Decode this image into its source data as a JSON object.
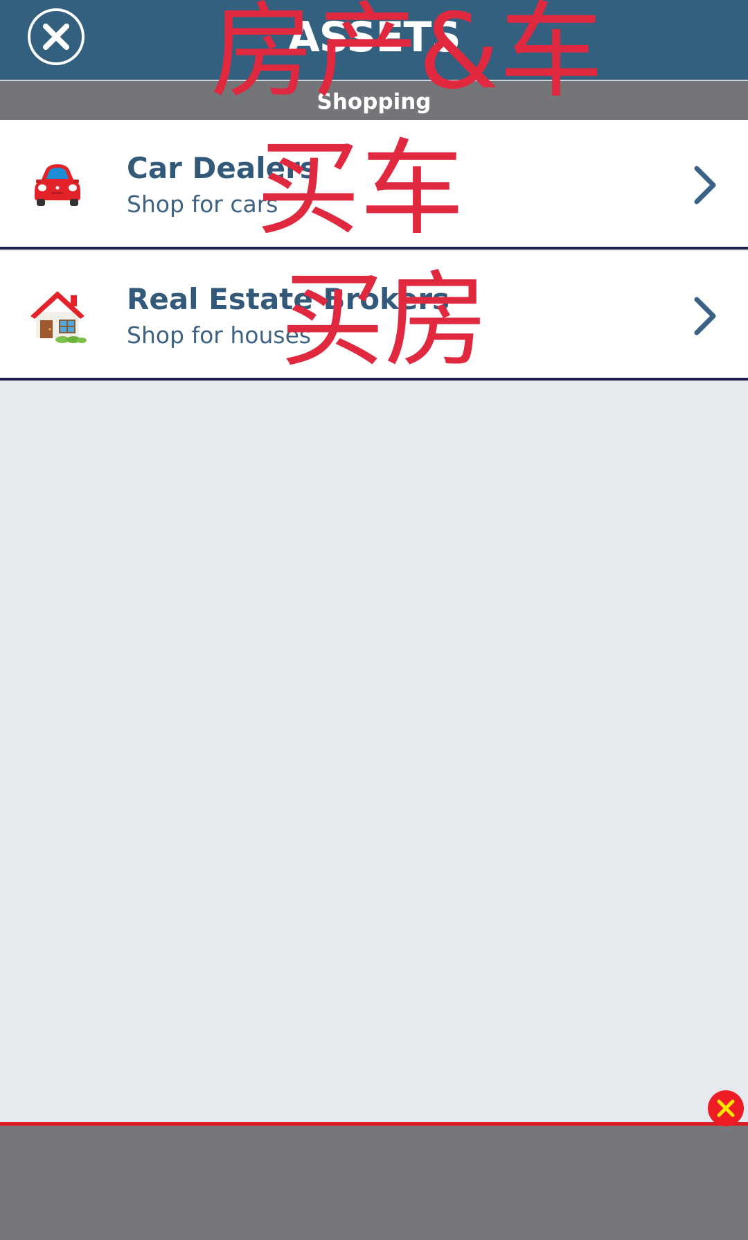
{
  "header": {
    "title": "ASSETS",
    "close_icon": "close-circle-icon",
    "background_color": "#34607f"
  },
  "subheader": {
    "title": "Shopping"
  },
  "items": [
    {
      "title": "Car Dealers",
      "subtitle": "Shop for cars",
      "icon": "car-icon",
      "chevron_icon": "chevron-right-icon"
    },
    {
      "title": "Real Estate Brokers",
      "subtitle": "Shop for houses",
      "icon": "house-icon",
      "chevron_icon": "chevron-right-icon"
    }
  ],
  "annotations": {
    "header_note": "房产&车",
    "car_note": "买车",
    "house_note": "买房",
    "color": "#e0283f"
  },
  "ad_bar": {
    "dismiss_icon": "close-x-icon"
  }
}
